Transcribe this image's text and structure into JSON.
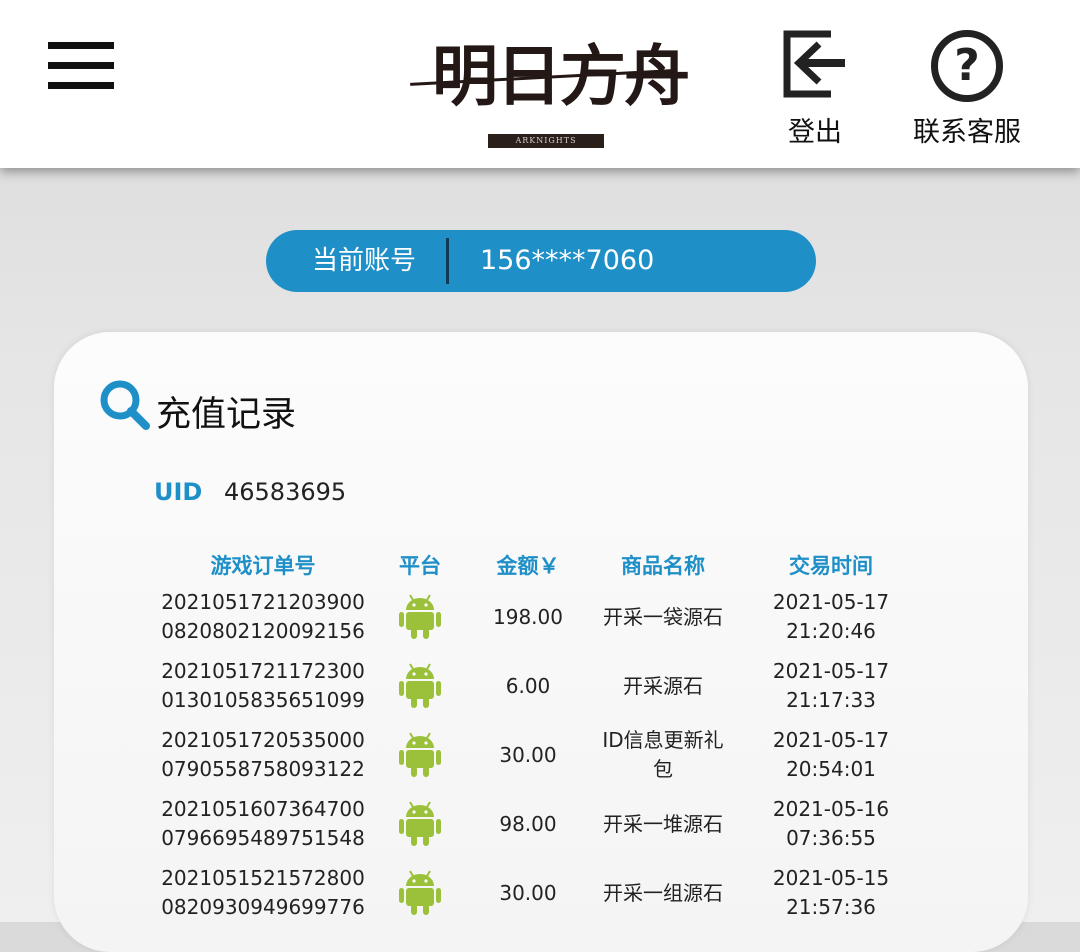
{
  "header": {
    "logo_text": "明日方舟",
    "logo_sub": "ARKNIGHTS",
    "logout_label": "登出",
    "support_label": "联系客服",
    "help_glyph": "?"
  },
  "account": {
    "label": "当前账号",
    "value": "156****7060"
  },
  "card": {
    "title": "充值记录",
    "uid_label": "UID",
    "uid_value": "46583695"
  },
  "table": {
    "headers": [
      "游戏订单号",
      "平台",
      "金额￥",
      "商品名称",
      "交易时间"
    ],
    "rows": [
      {
        "order": "20210517212039000820802120092156",
        "platform": "android-icon",
        "amount": "198.00",
        "product": "开采一袋源石",
        "time": "2021-05-17 21:20:46"
      },
      {
        "order": "20210517211723000130105835651099",
        "platform": "android-icon",
        "amount": "6.00",
        "product": "开采源石",
        "time": "2021-05-17 21:17:33"
      },
      {
        "order": "20210517205350000790558758093122",
        "platform": "android-icon",
        "amount": "30.00",
        "product": "ID信息更新礼包",
        "time": "2021-05-17 20:54:01"
      },
      {
        "order": "20210516073647000796695489751548",
        "platform": "android-icon",
        "amount": "98.00",
        "product": "开采一堆源石",
        "time": "2021-05-16 07:36:55"
      },
      {
        "order": "20210515215728000820930949699776",
        "platform": "android-icon",
        "amount": "30.00",
        "product": "开采一组源石",
        "time": "2021-05-15 21:57:36"
      }
    ]
  },
  "colors": {
    "accent": "#1f8fc8",
    "android": "#9bc13a"
  }
}
